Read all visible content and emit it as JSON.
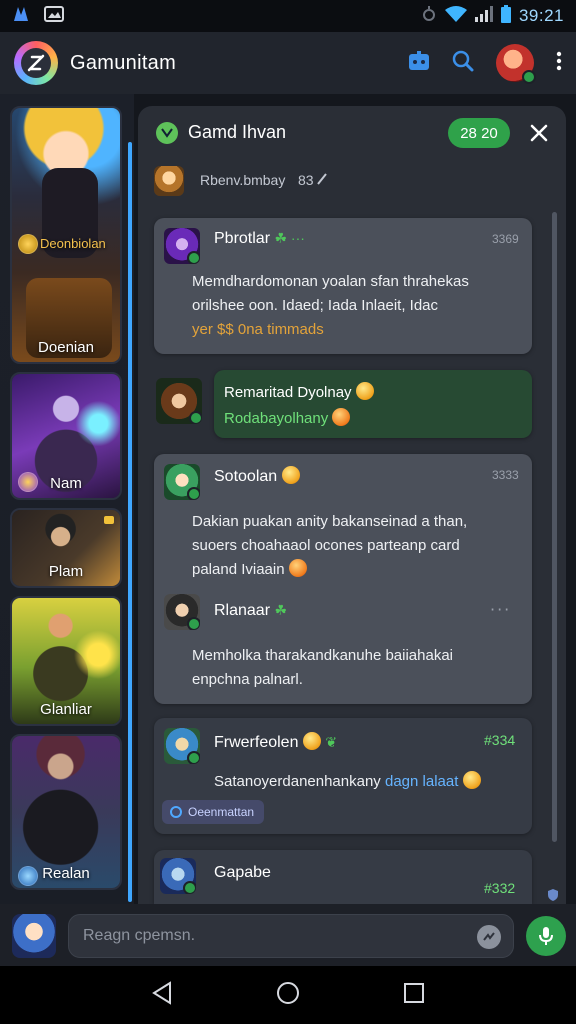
{
  "status_bar": {
    "time": "39:21"
  },
  "app_bar": {
    "title": "Gamunitam"
  },
  "sidebar": {
    "heroes": [
      {
        "name": "Doenian"
      },
      {
        "name": "Nam"
      },
      {
        "name": "Plam"
      },
      {
        "name": "Glanliar"
      },
      {
        "name": "Realan"
      }
    ],
    "first_overlay_label": "Deonbiolan"
  },
  "chat": {
    "title": "Gamd Ihvan",
    "count": "28 20",
    "subheader": {
      "text": "Rbenv.bmbay",
      "count": "83"
    },
    "messages": [
      {
        "name": "Pbrotlar",
        "time": "3369",
        "lines": [
          "Memdhardomonan yoalan sfan thrahekas",
          "orilshee oon. Idaed; Iada Inlaeit, Idac"
        ],
        "line3_highlight": "yer $$",
        "line3_rest": " 0na timmads"
      },
      {
        "name": "Remaritad Dyolnay",
        "subtitle": "Rodabayolhany"
      },
      {
        "name": "Sotoolan",
        "time": "3333",
        "lines": [
          "Dakian puakan anity bakanseinad a than,",
          "suoers choahaaol ocones parteanp card",
          "paland Iviaain"
        ]
      },
      {
        "name": "Rlanaar",
        "lines": [
          "Memholka tharakandkanuhe baiiahakai",
          "enpchna palnarl."
        ]
      },
      {
        "name": "Frwerfeolen",
        "time": "#334",
        "body_plain": "Satanoyerdanenhankany ",
        "body_link": "dagn lalaat",
        "tag": "Oeenmattan"
      },
      {
        "name": "Gapabe",
        "time": "#332"
      }
    ]
  },
  "input": {
    "placeholder": "Reagn cpemsn."
  }
}
